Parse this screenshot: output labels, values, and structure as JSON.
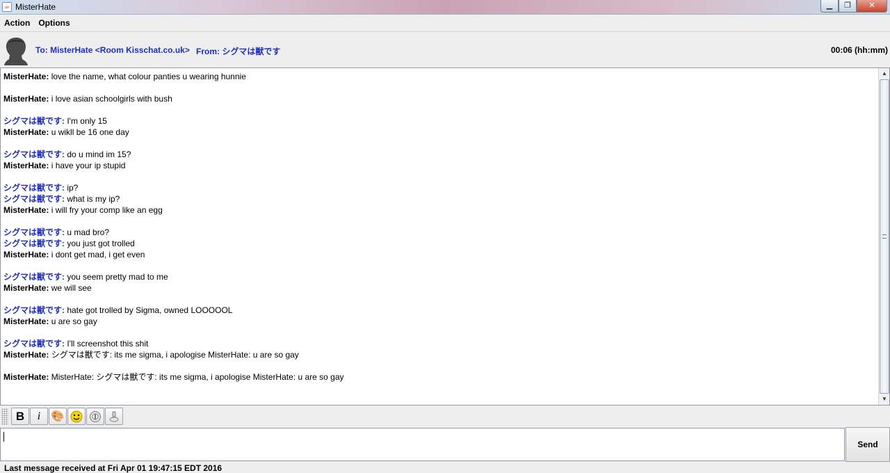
{
  "window": {
    "title": "MisterHate"
  },
  "menu": [
    "Action",
    "Options"
  ],
  "header": {
    "to": "To: MisterHate <Room Kisschat.co.uk>",
    "from": "From: シグマは獣です",
    "timer": "00:06 (hh:mm)"
  },
  "messages": [
    {
      "from": "MisterHate:",
      "text": " love the name, what colour panties u wearing hunnie",
      "self": true,
      "gap": false
    },
    {
      "from": "MisterHate:",
      "text": " i love asian schoolgirls with bush",
      "self": true,
      "gap": true
    },
    {
      "from": "シグマは獣です:",
      "text": "  I'm only 15",
      "self": false,
      "gap": true
    },
    {
      "from": "MisterHate:",
      "text": " u wikll be 16 one day",
      "self": true,
      "gap": false
    },
    {
      "from": "シグマは獣です:",
      "text": " do u mind im 15?",
      "self": false,
      "gap": true
    },
    {
      "from": "MisterHate:",
      "text": " i have your ip stupid",
      "self": true,
      "gap": false
    },
    {
      "from": "シグマは獣です:",
      "text": " ip?",
      "self": false,
      "gap": true
    },
    {
      "from": "シグマは獣です:",
      "text": " what is my ip?",
      "self": false,
      "gap": false
    },
    {
      "from": "MisterHate:",
      "text": " i will fry your comp like an egg",
      "self": true,
      "gap": false
    },
    {
      "from": "シグマは獣です:",
      "text": " u mad bro?",
      "self": false,
      "gap": true
    },
    {
      "from": "シグマは獣です:",
      "text": " you just got trolled",
      "self": false,
      "gap": false
    },
    {
      "from": "MisterHate:",
      "text": " i dont get mad, i get even",
      "self": true,
      "gap": false
    },
    {
      "from": "シグマは獣です:",
      "text": " you seem pretty mad to me",
      "self": false,
      "gap": true
    },
    {
      "from": "MisterHate:",
      "text": " we will see",
      "self": true,
      "gap": false
    },
    {
      "from": "シグマは獣です:",
      "text": " hate got trolled by Sigma, owned LOOOOOL",
      "self": false,
      "gap": true
    },
    {
      "from": "MisterHate:",
      "text": " u are so gay",
      "self": true,
      "gap": false
    },
    {
      "from": "シグマは獣です:",
      "text": " I'll screenshot this shit",
      "self": false,
      "gap": true
    },
    {
      "from": "MisterHate:",
      "text": " シグマは獣です: its me sigma, i apologise MisterHate: u are so gay",
      "self": true,
      "gap": false
    },
    {
      "from": "MisterHate:",
      "text": " MisterHate: シグマは獣です: its me sigma, i apologise MisterHate: u are so gay",
      "self": true,
      "gap": true
    }
  ],
  "toolbar": {
    "bold": "B",
    "italic": "i",
    "icons": [
      "color-palette-icon",
      "smiley-icon",
      "sound-icon",
      "buzz-icon"
    ]
  },
  "input": {
    "value": ""
  },
  "send_label": "Send",
  "status": "Last message received at Fri Apr 01 19:47:15 EDT 2016",
  "colors": {
    "other_user": "#1d2fc0",
    "self_user": "#000000"
  }
}
